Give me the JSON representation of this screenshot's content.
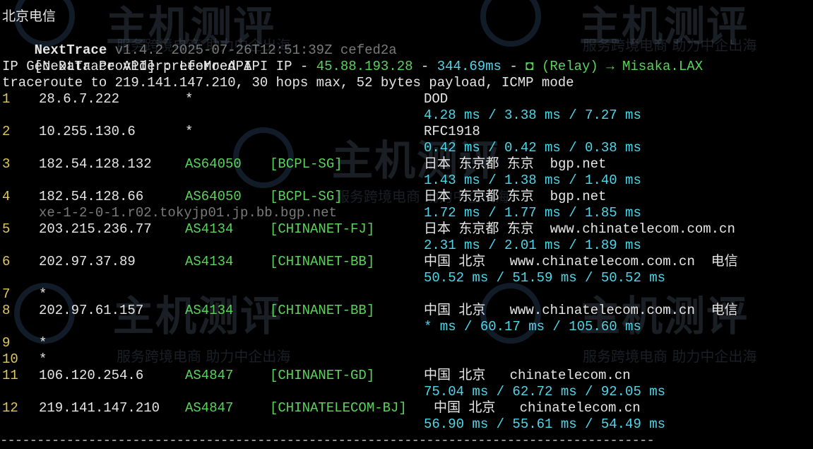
{
  "header": {
    "separator_top": "-----------------------------------------------------------------------------------------",
    "title": "北京电信",
    "version_name": "NextTrace",
    "version_info": "v1.4.2 2025-07-26T12:51:39Z cefed2a",
    "api_prefix": "[NextTrace API] preferred API IP - ",
    "api_ip": "45.88.193.28",
    "api_sep": " - ",
    "api_latency": "344.69ms",
    "api_dash": " - ",
    "api_relay": "(Relay) → Misaka.LAX",
    "geo_provider": "IP Geo Data Provider: LeoMoeAPI",
    "traceroute": "traceroute to 219.141.147.210, 30 hops max, 52 bytes payload, ICMP mode"
  },
  "hops": [
    {
      "n": "1",
      "ip": "28.6.7.222",
      "asn": "*",
      "tag": "",
      "geo": "DOD",
      "rtt": "4.28 ms / 3.38 ms / 7.27 ms"
    },
    {
      "n": "2",
      "ip": "10.255.130.6",
      "asn": "*",
      "tag": "",
      "geo": "RFC1918",
      "rtt": "0.42 ms / 0.42 ms / 0.38 ms"
    },
    {
      "n": "3",
      "ip": "182.54.128.132",
      "asn": "AS64050",
      "tag": "[BCPL-SG]",
      "geo": "日本 东京都 东京  bgp.net",
      "rtt": "1.43 ms / 1.38 ms / 1.40 ms"
    },
    {
      "n": "4",
      "ip": "182.54.128.66",
      "asn": "AS64050",
      "tag": "[BCPL-SG]",
      "geo": "日本 东京都 东京  bgp.net",
      "rdns": "xe-1-2-0-1.r02.tokyjp01.jp.bb.bgp.net",
      "rtt": "1.72 ms / 1.77 ms / 1.85 ms"
    },
    {
      "n": "5",
      "ip": "203.215.236.77",
      "asn": "AS4134",
      "tag": "[CHINANET-FJ]",
      "geo": "日本 东京都 东京  www.chinatelecom.com.cn",
      "rtt": "2.31 ms / 2.01 ms / 1.89 ms"
    },
    {
      "n": "6",
      "ip": "202.97.37.89",
      "asn": "AS4134",
      "tag": "[CHINANET-BB]",
      "geo": "中国 北京   www.chinatelecom.com.cn  电信",
      "rtt": "50.52 ms / 51.59 ms / 50.52 ms"
    },
    {
      "n": "7",
      "ip": "*"
    },
    {
      "n": "8",
      "ip": "202.97.61.157",
      "asn": "AS4134",
      "tag": "[CHINANET-BB]",
      "geo": "中国 北京   www.chinatelecom.com.cn  电信",
      "rtt": "* ms / 60.17 ms / 105.60 ms"
    },
    {
      "n": "9",
      "ip": "*"
    },
    {
      "n": "10",
      "ip": "*"
    },
    {
      "n": "11",
      "ip": "106.120.254.6",
      "asn": "AS4847",
      "tag": "[CHINANET-GD]",
      "geo": "中国 北京   chinatelecom.cn",
      "rtt": "75.04 ms / 62.72 ms / 92.05 ms"
    },
    {
      "n": "12",
      "ip": "219.141.147.210",
      "asn": "AS4847",
      "tag": "[CHINATELECOM-BJ]",
      "geo": "中国 北京   chinatelecom.cn",
      "rtt": "56.90 ms / 55.61 ms / 54.49 ms"
    }
  ],
  "footer": {
    "separator_bottom": "-----------------------------------------------------------------------------------------"
  },
  "watermark": {
    "brand": "主机测评",
    "slogan": "服务跨境电商 助力中企出海"
  },
  "colors": {
    "bg": "#000000",
    "text": "#e6e6e6",
    "hop_number": "#e0c75a",
    "asn": "#59d35a",
    "rtt": "#4fd6e8"
  }
}
